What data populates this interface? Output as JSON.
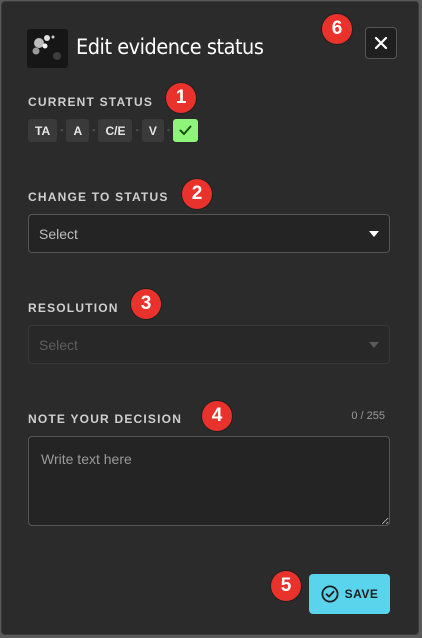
{
  "dialog": {
    "title": "Edit evidence status",
    "close_icon": "close-icon"
  },
  "current_status": {
    "label": "CURRENT STATUS",
    "chips": [
      "TA",
      "A",
      "C/E",
      "V"
    ],
    "separator": "-",
    "active_icon": "check-icon",
    "active_color": "#8ef57a"
  },
  "change_status": {
    "label": "CHANGE TO STATUS",
    "placeholder": "Select"
  },
  "resolution": {
    "label": "RESOLUTION",
    "placeholder": "Select"
  },
  "note": {
    "label": "NOTE YOUR DECISION",
    "counter": "0 / 255",
    "placeholder": "Write text here"
  },
  "save": {
    "label": "SAVE",
    "icon": "check-circle-icon",
    "color": "#5ad4ec"
  },
  "badges": [
    "1",
    "2",
    "3",
    "4",
    "5",
    "6"
  ],
  "badge_color": "#e8322b"
}
